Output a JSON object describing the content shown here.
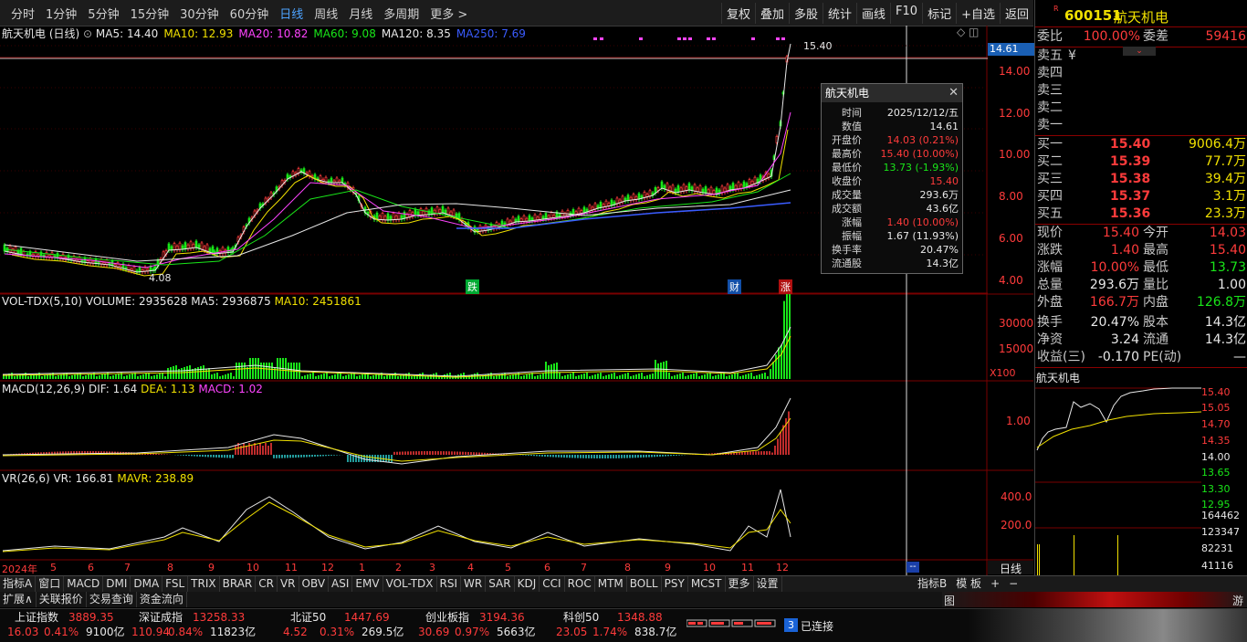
{
  "toolbar": {
    "periods": [
      "分时",
      "1分钟",
      "5分钟",
      "15分钟",
      "30分钟",
      "60分钟",
      "日线",
      "周线",
      "月线",
      "多周期",
      "更多 >"
    ],
    "active": "日线",
    "actions": [
      "复权",
      "叠加",
      "多股",
      "统计",
      "画线",
      "F10",
      "标记",
      "+自选",
      "返回"
    ]
  },
  "main": {
    "title": "航天机电 (日线)",
    "ma": [
      {
        "label": "MA5: 14.40",
        "color": "#e8e8e8"
      },
      {
        "label": "MA10: 12.93",
        "color": "#f0e000"
      },
      {
        "label": "MA20: 10.82",
        "color": "#ff44ff"
      },
      {
        "label": "MA60: 9.08",
        "color": "#19e619"
      },
      {
        "label": "MA120: 8.35",
        "color": "#e8e8e8"
      },
      {
        "label": "MA250: 7.69",
        "color": "#3a5cff"
      }
    ],
    "y_labels": [
      "14.00",
      "12.00",
      "10.00",
      "8.00",
      "6.00",
      "4.00"
    ],
    "cur_price": "14.61",
    "high_label": "15.40",
    "low_label": "4.08",
    "markers": [
      "跌",
      "财",
      "涨"
    ]
  },
  "vol": {
    "title": "VOL-TDX(5,10)",
    "value": "VOLUME: 2935628",
    "ma5": "MA5: 2936875",
    "ma10": "MA10: 2451861",
    "y_labels": [
      "30000",
      "15000"
    ],
    "unit": "X100"
  },
  "macd": {
    "title": "MACD(12,26,9)",
    "dif": "DIF: 1.64",
    "dea": "DEA: 1.13",
    "macd": "MACD: 1.02",
    "y_label": "1.00"
  },
  "vr": {
    "title": "VR(26,6)",
    "vr": "VR: 166.81",
    "mavr": "MAVR: 238.89",
    "y_labels": [
      "400.0",
      "200.0"
    ]
  },
  "xaxis": {
    "labels": [
      "2024年",
      "5",
      "6",
      "7",
      "8",
      "9",
      "10",
      "11",
      "12",
      "1",
      "2",
      "3",
      "4",
      "5",
      "6",
      "7",
      "8",
      "9",
      "10",
      "11",
      "12"
    ],
    "period_btn": "日线",
    "dash": "--"
  },
  "popup": {
    "title": "航天机电",
    "rows": [
      {
        "k": "时间",
        "v": "2025/12/12/五",
        "c": "#e8e8e8"
      },
      {
        "k": "数值",
        "v": "14.61",
        "c": "#e8e8e8"
      },
      {
        "k": "开盘价",
        "v": "14.03 (0.21%)",
        "c": "#ff3b3b"
      },
      {
        "k": "最高价",
        "v": "15.40 (10.00%)",
        "c": "#ff3b3b"
      },
      {
        "k": "最低价",
        "v": "13.73 (-1.93%)",
        "c": "#19e619"
      },
      {
        "k": "收盘价",
        "v": "15.40",
        "c": "#ff3b3b"
      },
      {
        "k": "成交量",
        "v": "293.6万",
        "c": "#e8e8e8"
      },
      {
        "k": "成交额",
        "v": "43.6亿",
        "c": "#e8e8e8"
      },
      {
        "k": "涨幅",
        "v": "1.40 (10.00%)",
        "c": "#ff3b3b"
      },
      {
        "k": "振幅",
        "v": "1.67 (11.93%)",
        "c": "#e8e8e8"
      },
      {
        "k": "换手率",
        "v": "20.47%",
        "c": "#e8e8e8"
      },
      {
        "k": "流通股",
        "v": "14.3亿",
        "c": "#e8e8e8"
      }
    ]
  },
  "quote": {
    "code": "600151",
    "name": "航天机电",
    "badge": "R",
    "weibi_l": "委比",
    "weibi": "100.00%",
    "weicha_l": "委差",
    "weicha": "59416",
    "asks": [
      {
        "l": "卖五",
        "p": "¥"
      },
      {
        "l": "卖四",
        "p": ""
      },
      {
        "l": "卖三",
        "p": ""
      },
      {
        "l": "卖二",
        "p": ""
      },
      {
        "l": "卖一",
        "p": ""
      }
    ],
    "bids": [
      {
        "l": "买一",
        "p": "15.40",
        "v": "9006.4万"
      },
      {
        "l": "买二",
        "p": "15.39",
        "v": "77.7万"
      },
      {
        "l": "买三",
        "p": "15.38",
        "v": "39.4万"
      },
      {
        "l": "买四",
        "p": "15.37",
        "v": "3.1万"
      },
      {
        "l": "买五",
        "p": "15.36",
        "v": "23.3万"
      }
    ],
    "stats": [
      {
        "l1": "现价",
        "v1": "15.40",
        "c1": "#ff3b3b",
        "l2": "今开",
        "v2": "14.03",
        "c2": "#ff3b3b"
      },
      {
        "l1": "涨跌",
        "v1": "1.40",
        "c1": "#ff3b3b",
        "l2": "最高",
        "v2": "15.40",
        "c2": "#ff3b3b"
      },
      {
        "l1": "涨幅",
        "v1": "10.00%",
        "c1": "#ff3b3b",
        "l2": "最低",
        "v2": "13.73",
        "c2": "#19e619"
      },
      {
        "l1": "总量",
        "v1": "293.6万",
        "c1": "#e8e8e8",
        "l2": "量比",
        "v2": "1.00",
        "c2": "#e8e8e8"
      },
      {
        "l1": "外盘",
        "v1": "166.7万",
        "c1": "#ff3b3b",
        "l2": "内盘",
        "v2": "126.8万",
        "c2": "#19e619"
      },
      {
        "l1": "换手",
        "v1": "20.47%",
        "c1": "#e8e8e8",
        "l2": "股本",
        "v2": "14.3亿",
        "c2": "#e8e8e8"
      },
      {
        "l1": "净资",
        "v1": "3.24",
        "c1": "#e8e8e8",
        "l2": "流通",
        "v2": "14.3亿",
        "c2": "#e8e8e8"
      },
      {
        "l1": "收益(三)",
        "v1": "-0.170",
        "c1": "#e8e8e8",
        "l2": "PE(动)",
        "v2": "—",
        "c2": "#e8e8e8"
      }
    ],
    "mini_title": "航天机电",
    "mini_y": [
      "15.40",
      "15.05",
      "14.70",
      "14.35",
      "14.00",
      "13.65",
      "13.30",
      "12.95"
    ],
    "mini_vol_y": [
      "164462",
      "123347",
      "82231",
      "41116"
    ]
  },
  "tabs": [
    "指标A",
    "窗口",
    "MACD",
    "DMI",
    "DMA",
    "FSL",
    "TRIX",
    "BRAR",
    "CR",
    "VR",
    "OBV",
    "ASI",
    "EMV",
    "VOL-TDX",
    "RSI",
    "WR",
    "SAR",
    "KDJ",
    "CCI",
    "ROC",
    "MTM",
    "BOLL",
    "PSY",
    "MCST",
    "更多",
    "设置"
  ],
  "tabs_right": [
    "指标B",
    "模 板",
    "+",
    "−"
  ],
  "tabs2": [
    "扩展∧",
    "关联报价",
    "交易查询",
    "资金流向"
  ],
  "indices": [
    {
      "name": "上证指数",
      "val": "3889.35",
      "chg": "16.03",
      "pct": "0.41%",
      "amt": "9100亿"
    },
    {
      "name": "深证成指",
      "val": "13258.33",
      "chg": "110.94",
      "pct": "0.84%",
      "amt": "11823亿"
    },
    {
      "name": "北证50",
      "val": "1447.69",
      "chg": "4.52",
      "pct": "0.31%",
      "amt": "269.5亿"
    },
    {
      "name": "创业板指",
      "val": "3194.36",
      "chg": "30.69",
      "pct": "0.97%",
      "amt": "5663亿"
    },
    {
      "name": "科创50",
      "val": "1348.88",
      "chg": "23.05",
      "pct": "1.74%",
      "amt": "838.7亿"
    }
  ],
  "conn": {
    "num": "3",
    "text": "已连接"
  }
}
